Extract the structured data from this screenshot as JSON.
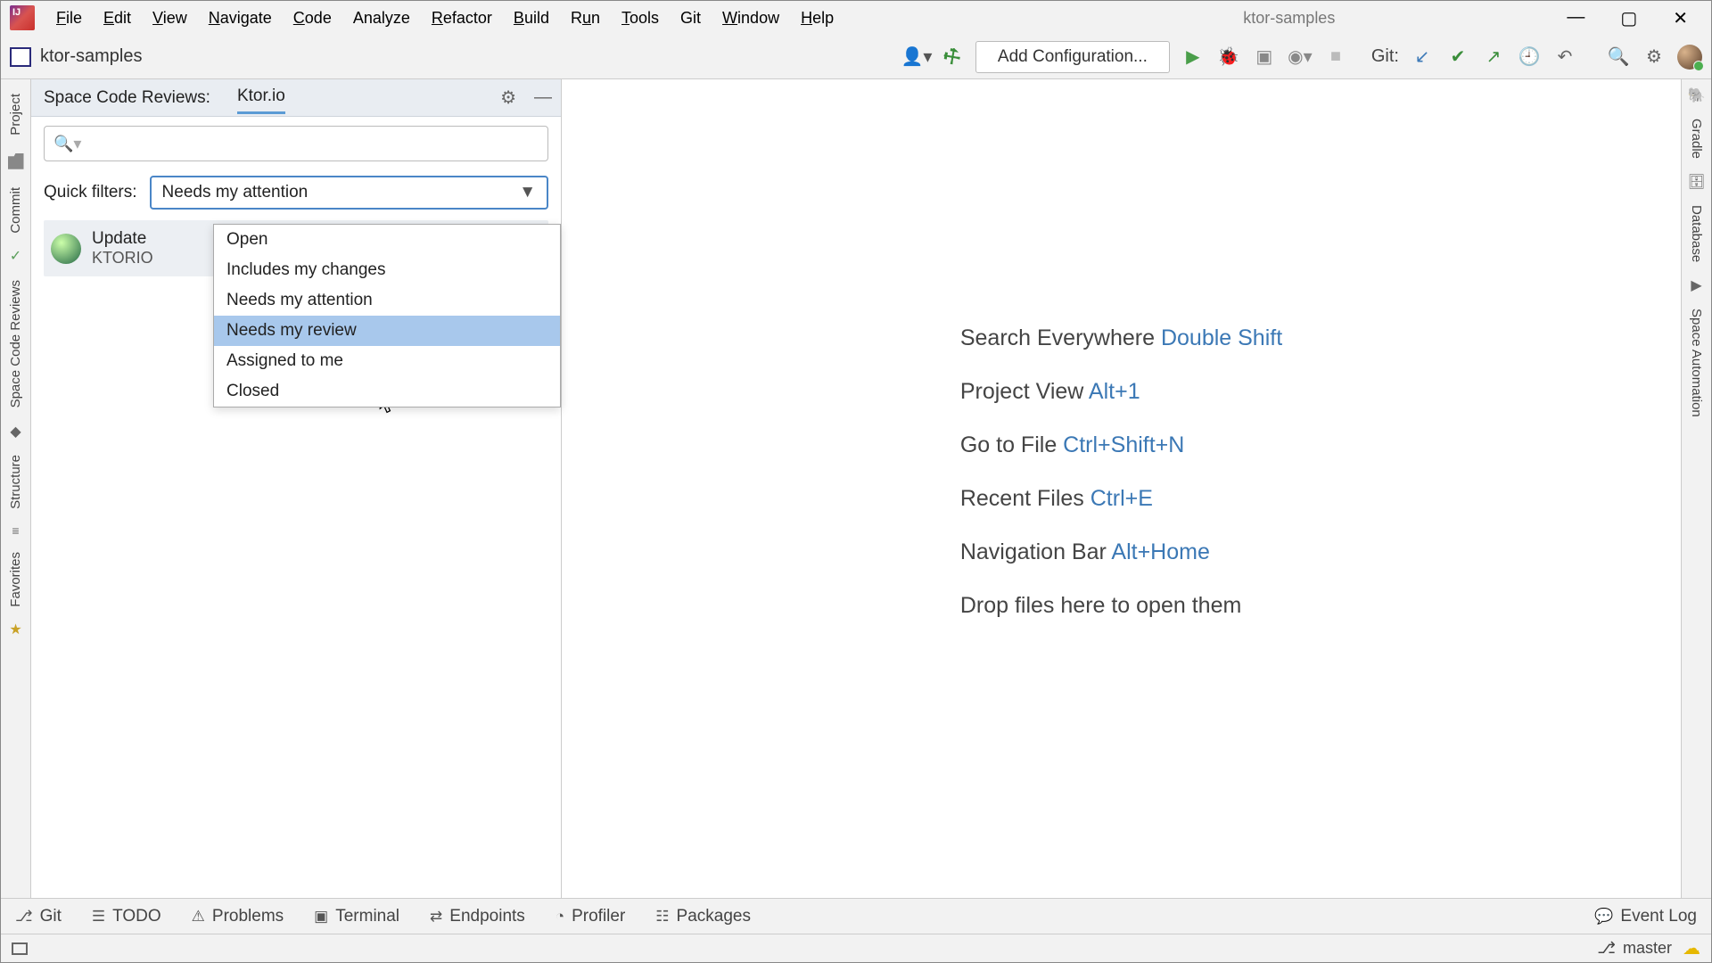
{
  "window": {
    "project_name": "ktor-samples"
  },
  "menu": {
    "items": [
      "File",
      "Edit",
      "View",
      "Navigate",
      "Code",
      "Analyze",
      "Refactor",
      "Build",
      "Run",
      "Tools",
      "Git",
      "Window",
      "Help"
    ]
  },
  "toolbar": {
    "project_name": "ktor-samples",
    "run_config": "Add Configuration...",
    "git_label": "Git:"
  },
  "left_tools": {
    "project": "Project",
    "commit": "Commit",
    "reviews": "Space Code Reviews",
    "structure": "Structure",
    "favorites": "Favorites"
  },
  "right_tools": {
    "gradle": "Gradle",
    "database": "Database",
    "automation": "Space Automation"
  },
  "panel": {
    "title": "Space Code Reviews:",
    "tab": "Ktor.io",
    "search_placeholder": "",
    "filter_label": "Quick filters:",
    "filter_value": "Needs my attention",
    "filter_options": [
      "Open",
      "Includes my changes",
      "Needs my attention",
      "Needs my review",
      "Assigned to me",
      "Closed"
    ],
    "review": {
      "line1": "Update",
      "line2": "KTORIO"
    }
  },
  "hints": [
    {
      "label": "Search Everywhere",
      "kb": "Double Shift"
    },
    {
      "label": "Project View",
      "kb": "Alt+1"
    },
    {
      "label": "Go to File",
      "kb": "Ctrl+Shift+N"
    },
    {
      "label": "Recent Files",
      "kb": "Ctrl+E"
    },
    {
      "label": "Navigation Bar",
      "kb": "Alt+Home"
    }
  ],
  "hints_dropline": "Drop files here to open them",
  "bottom": {
    "git": "Git",
    "todo": "TODO",
    "problems": "Problems",
    "terminal": "Terminal",
    "endpoints": "Endpoints",
    "profiler": "Profiler",
    "packages": "Packages",
    "eventlog": "Event Log"
  },
  "status": {
    "branch": "master"
  },
  "colors": {
    "accent": "#3b78b5",
    "selection": "#a8c8ec"
  }
}
